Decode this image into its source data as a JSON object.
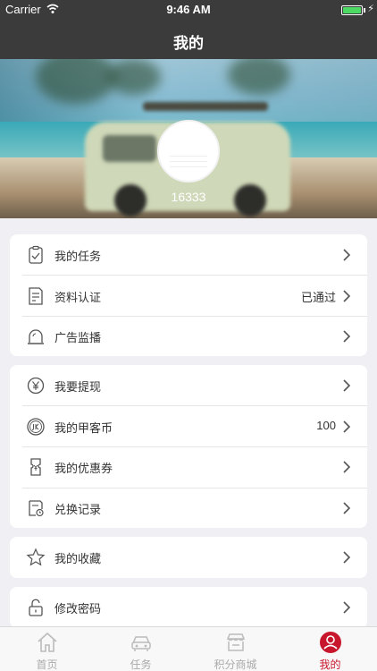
{
  "status_bar": {
    "carrier": "Carrier",
    "time": "9:46 AM",
    "battery_level": 1.0
  },
  "nav": {
    "title": "我的"
  },
  "profile": {
    "username": "16333"
  },
  "sections": [
    {
      "items": [
        {
          "label": "我的任务",
          "value": "",
          "icon": "clipboard-check-icon"
        },
        {
          "label": "资料认证",
          "value": "已通过",
          "icon": "document-edit-icon"
        },
        {
          "label": "广告监播",
          "value": "",
          "icon": "siren-icon"
        }
      ]
    },
    {
      "items": [
        {
          "label": "我要提现",
          "value": "",
          "icon": "yen-coin-icon"
        },
        {
          "label": "我的甲客币",
          "value": "100",
          "icon": "jk-coin-icon"
        },
        {
          "label": "我的优惠券",
          "value": "",
          "icon": "coupon-icon"
        },
        {
          "label": "兑换记录",
          "value": "",
          "icon": "exchange-record-icon"
        }
      ]
    },
    {
      "items": [
        {
          "label": "我的收藏",
          "value": "",
          "icon": "star-icon"
        }
      ]
    },
    {
      "items": [
        {
          "label": "修改密码",
          "value": "",
          "icon": "unlock-icon"
        }
      ]
    }
  ],
  "tabs": [
    {
      "label": "首页",
      "icon": "home-icon",
      "active": false
    },
    {
      "label": "任务",
      "icon": "car-icon",
      "active": false
    },
    {
      "label": "积分商城",
      "icon": "store-icon",
      "active": false
    },
    {
      "label": "我的",
      "icon": "user-icon",
      "active": true
    }
  ],
  "colors": {
    "header_bg": "#3b3b3b",
    "accent": "#c8162c",
    "page_bg": "#f0eff4",
    "battery": "#4cd964"
  }
}
